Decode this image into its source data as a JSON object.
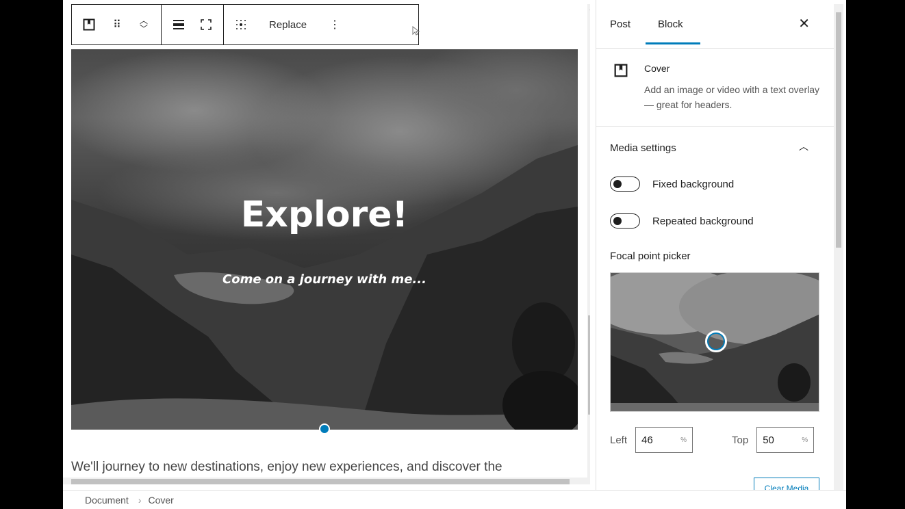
{
  "toolbar": {
    "replace_label": "Replace"
  },
  "cover": {
    "title": "Explore!",
    "subtitle": "Come on a journey with me..."
  },
  "paragraph": "We'll journey to new destinations, enjoy new experiences, and discover the",
  "sidebar": {
    "tabs": [
      "Post",
      "Block"
    ],
    "active_tab": "Block",
    "block_name": "Cover",
    "block_description": "Add an image or video with a text overlay — great for headers.",
    "panel_title": "Media settings",
    "toggles": [
      {
        "label": "Fixed background",
        "on": false
      },
      {
        "label": "Repeated background",
        "on": false
      }
    ],
    "focal_label": "Focal point picker",
    "left_label": "Left",
    "left_value": "46",
    "top_label": "Top",
    "top_value": "50",
    "unit": "%",
    "clear_media_label": "Clear Media"
  },
  "breadcrumb": [
    "Document",
    "Cover"
  ],
  "colors": {
    "accent": "#007cba"
  }
}
